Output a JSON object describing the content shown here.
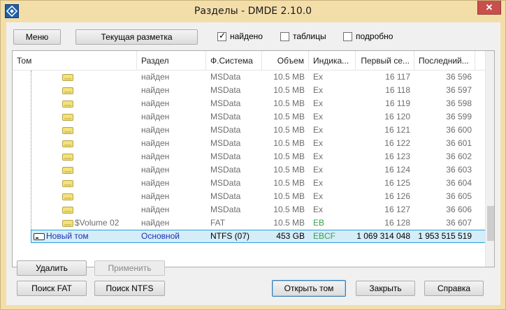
{
  "window": {
    "title": "Разделы - DMDE 2.10.0",
    "close_glyph": "✕"
  },
  "toolbar": {
    "menu_label": "Меню",
    "layout_label": "Текущая разметка",
    "found": {
      "label": "найдено",
      "checked": true
    },
    "tables": {
      "label": "таблицы",
      "checked": false
    },
    "detailed": {
      "label": "подробно",
      "checked": false
    }
  },
  "table": {
    "columns": [
      "Том",
      "Раздел",
      "Ф.Система",
      "Объем",
      "Индика...",
      "Первый се...",
      "Последний..."
    ],
    "rows": [
      {
        "name": "",
        "part": "найден",
        "fs": "MSData",
        "size": "10.5 MB",
        "ind": "Ex",
        "first": "16 117",
        "last": "36 596"
      },
      {
        "name": "",
        "part": "найден",
        "fs": "MSData",
        "size": "10.5 MB",
        "ind": "Ex",
        "first": "16 118",
        "last": "36 597"
      },
      {
        "name": "",
        "part": "найден",
        "fs": "MSData",
        "size": "10.5 MB",
        "ind": "Ex",
        "first": "16 119",
        "last": "36 598"
      },
      {
        "name": "",
        "part": "найден",
        "fs": "MSData",
        "size": "10.5 MB",
        "ind": "Ex",
        "first": "16 120",
        "last": "36 599"
      },
      {
        "name": "",
        "part": "найден",
        "fs": "MSData",
        "size": "10.5 MB",
        "ind": "Ex",
        "first": "16 121",
        "last": "36 600"
      },
      {
        "name": "",
        "part": "найден",
        "fs": "MSData",
        "size": "10.5 MB",
        "ind": "Ex",
        "first": "16 122",
        "last": "36 601"
      },
      {
        "name": "",
        "part": "найден",
        "fs": "MSData",
        "size": "10.5 MB",
        "ind": "Ex",
        "first": "16 123",
        "last": "36 602"
      },
      {
        "name": "",
        "part": "найден",
        "fs": "MSData",
        "size": "10.5 MB",
        "ind": "Ex",
        "first": "16 124",
        "last": "36 603"
      },
      {
        "name": "",
        "part": "найден",
        "fs": "MSData",
        "size": "10.5 MB",
        "ind": "Ex",
        "first": "16 125",
        "last": "36 604"
      },
      {
        "name": "",
        "part": "найден",
        "fs": "MSData",
        "size": "10.5 MB",
        "ind": "Ex",
        "first": "16 126",
        "last": "36 605"
      },
      {
        "name": "",
        "part": "найден",
        "fs": "MSData",
        "size": "10.5 MB",
        "ind": "Ex",
        "first": "16 127",
        "last": "36 606"
      },
      {
        "name": "$Volume 02",
        "part": "найден",
        "fs": "FAT",
        "size": "10.5 MB",
        "ind": "EB",
        "first": "16 128",
        "last": "36 607"
      },
      {
        "name": "Новый том",
        "part": "Основной",
        "fs": "NTFS (07)",
        "size": "453 GB",
        "ind": "EBCF",
        "first": "1 069 314 048",
        "last": "1 953 515 519"
      }
    ]
  },
  "buttons": {
    "delete": "Удалить",
    "apply": "Применить",
    "search_fat": "Поиск FAT",
    "search_ntfs": "Поиск NTFS",
    "open_volume": "Открыть том",
    "close": "Закрыть",
    "help": "Справка"
  },
  "colors": {
    "title_bar": "#f3deaa",
    "selection": "#cde8f7",
    "indicator_green": "#3aa04b",
    "name_blue": "#1a33b0"
  }
}
